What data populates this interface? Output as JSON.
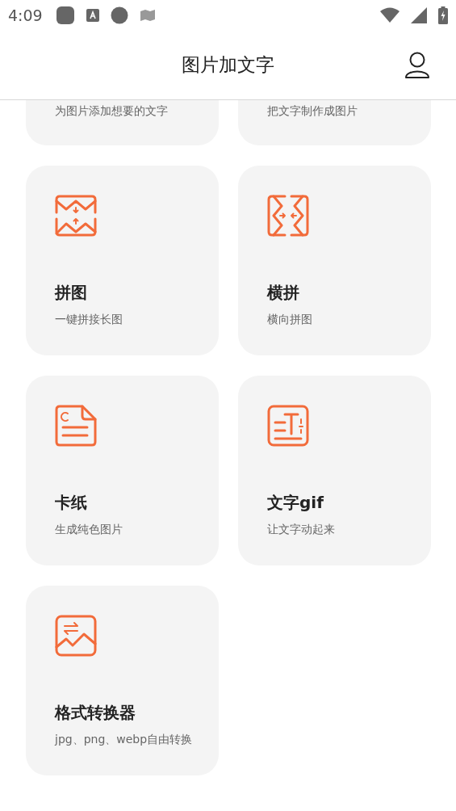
{
  "status_bar": {
    "time": "4:09"
  },
  "header": {
    "title": "图片加文字"
  },
  "tools": [
    {
      "kind": "clipped",
      "subtitle": "为图片添加想要的文字"
    },
    {
      "kind": "clipped",
      "subtitle": "把文字制作成图片"
    },
    {
      "kind": "full",
      "title": "拼图",
      "subtitle": "一键拼接长图"
    },
    {
      "kind": "full",
      "title": "横拼",
      "subtitle": "横向拼图"
    },
    {
      "kind": "full",
      "title": "卡纸",
      "subtitle": "生成纯色图片"
    },
    {
      "kind": "full",
      "title": "文字gif",
      "subtitle": "让文字动起来"
    },
    {
      "kind": "full",
      "title": "格式转换器",
      "subtitle": "jpg、png、webp自由转换"
    }
  ]
}
